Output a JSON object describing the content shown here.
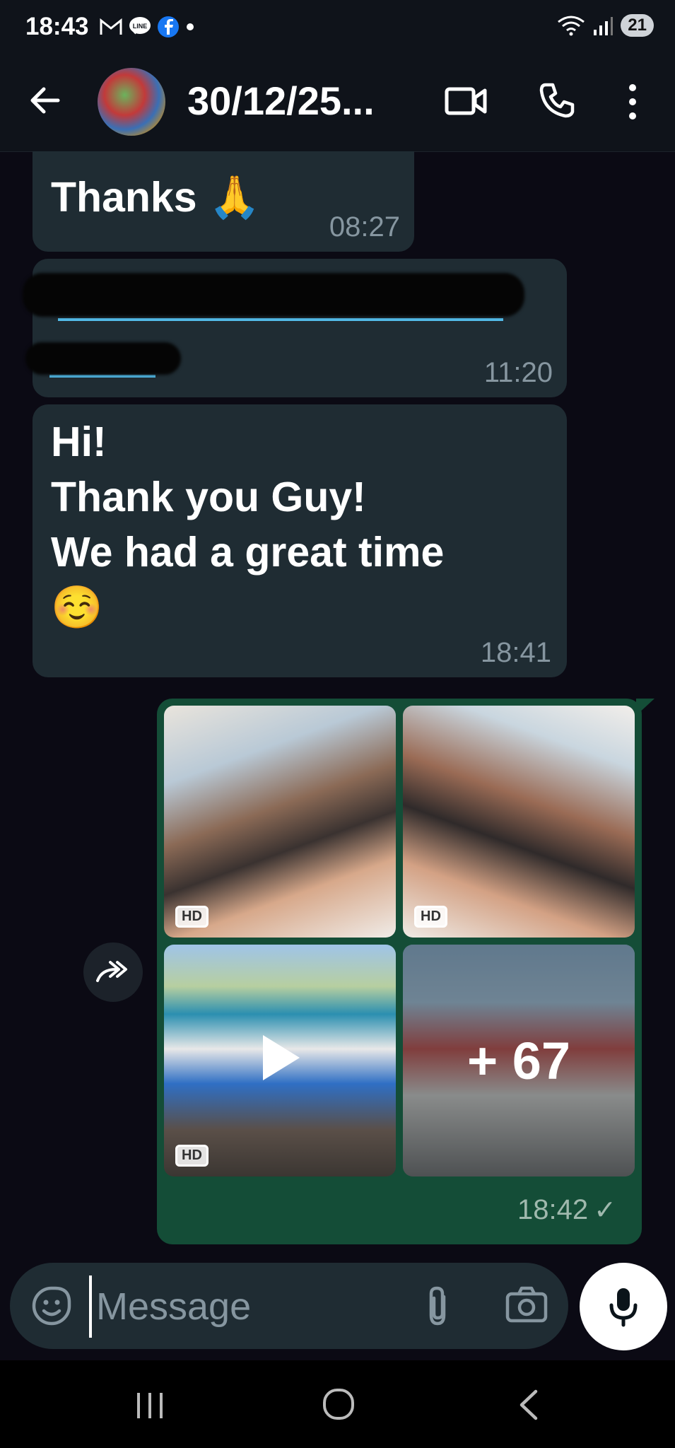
{
  "status_bar": {
    "time": "18:43",
    "battery": "21"
  },
  "header": {
    "title": "30/12/25..."
  },
  "messages": [
    {
      "text": "Thanks 🙏",
      "time": "08:27"
    },
    {
      "text": "",
      "time": "11:20"
    },
    {
      "text": "Hi!\nThank you Guy!\nWe had a great time\n☺️",
      "time": "18:41"
    }
  ],
  "outgoing": {
    "more_count": "+ 67",
    "time": "18:42",
    "tick": "✓",
    "hd_label": "HD"
  },
  "input": {
    "placeholder": "Message"
  },
  "colors": {
    "incoming_bubble": "#1f2c33",
    "outgoing_bubble": "#144d37",
    "background": "#0b0a14"
  }
}
